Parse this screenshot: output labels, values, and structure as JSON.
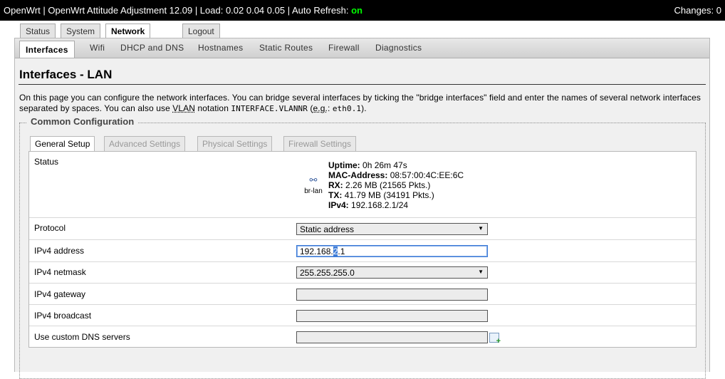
{
  "header": {
    "title": "OpenWrt | OpenWrt Attitude Adjustment 12.09 | Load: 0.02 0.04 0.05 | Auto Refresh:",
    "auto_refresh": "on",
    "changes": "Changes: 0"
  },
  "main_tabs": [
    "Status",
    "System",
    "Network",
    "Logout"
  ],
  "sub_tabs": [
    "Interfaces",
    "Wifi",
    "DHCP and DNS",
    "Hostnames",
    "Static Routes",
    "Firewall",
    "Diagnostics"
  ],
  "page": {
    "title": "Interfaces - LAN",
    "desc_1": "On this page you can configure the network interfaces. You can bridge several interfaces by ticking the \"bridge interfaces\" field and enter the names of several network interfaces separated by spaces. You can also use ",
    "desc_vlan": "VLAN",
    "desc_2": " notation ",
    "desc_code1": "INTERFACE.VLANNR",
    "desc_3": " (",
    "desc_eg": "e.g.",
    "desc_4": ": ",
    "desc_code2": "eth0.1",
    "desc_5": ")."
  },
  "section": {
    "legend": "Common Configuration",
    "tabs": [
      "General Setup",
      "Advanced Settings",
      "Physical Settings",
      "Firewall Settings"
    ]
  },
  "status": {
    "label": "Status",
    "iface": "br-lan",
    "uptime_label": "Uptime:",
    "uptime": "0h 26m 47s",
    "mac_label": "MAC-Address:",
    "mac": "08:57:00:4C:EE:6C",
    "rx_label": "RX:",
    "rx": "2.26 MB (21565 Pkts.)",
    "tx_label": "TX:",
    "tx": "41.79 MB (34191 Pkts.)",
    "ipv4_label": "IPv4:",
    "ipv4": "192.168.2.1/24"
  },
  "fields": {
    "protocol_label": "Protocol",
    "protocol_value": "Static address",
    "ipv4_addr_label": "IPv4 address",
    "ipv4_addr_pre": "192.168.",
    "ipv4_addr_sel": "2",
    "ipv4_addr_post": ".1",
    "netmask_label": "IPv4 netmask",
    "netmask_value": "255.255.255.0",
    "gateway_label": "IPv4 gateway",
    "gateway_value": "",
    "broadcast_label": "IPv4 broadcast",
    "broadcast_value": "",
    "dns_label": "Use custom DNS servers",
    "dns_value": ""
  }
}
